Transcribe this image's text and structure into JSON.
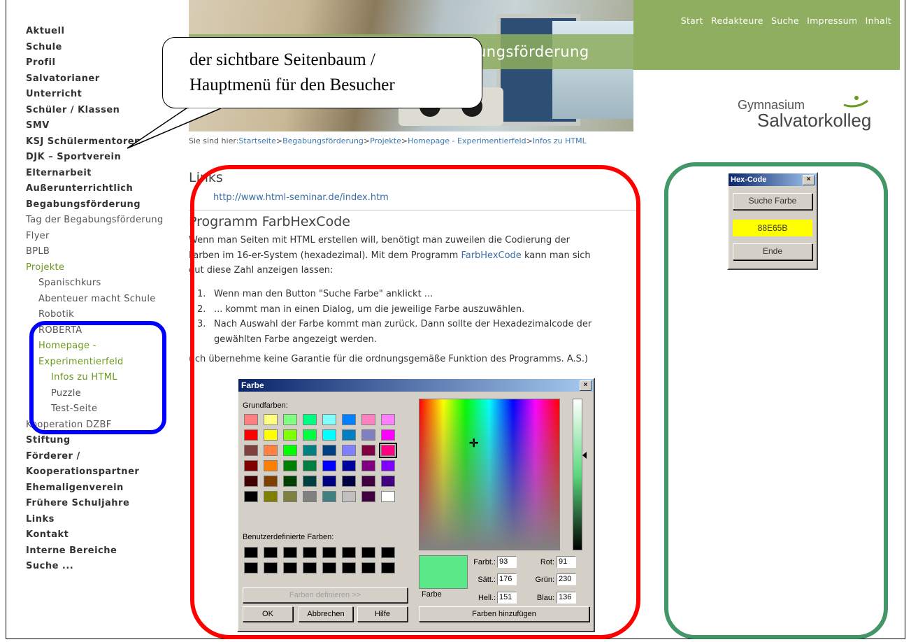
{
  "nav": {
    "items": [
      {
        "label": "Aktuell",
        "level": 0
      },
      {
        "label": "Schule",
        "level": 0
      },
      {
        "label": "Profil",
        "level": 0
      },
      {
        "label": "Salvatorianer",
        "level": 0
      },
      {
        "label": "Unterricht",
        "level": 0
      },
      {
        "label": "Schüler / Klassen",
        "level": 0
      },
      {
        "label": "SMV",
        "level": 0
      },
      {
        "label": "KSJ Schülermentoren",
        "level": 0
      },
      {
        "label": "DJK – Sportverein",
        "level": 0
      },
      {
        "label": "Elternarbeit",
        "level": 0
      },
      {
        "label": "Außerunterrichtlich",
        "level": 0
      },
      {
        "label": "Begabungsförderung",
        "level": 0
      },
      {
        "label": "Tag der Begabungsförderung",
        "level": 1
      },
      {
        "label": "Flyer",
        "level": 1
      },
      {
        "label": "BPLB",
        "level": 1
      },
      {
        "label": "Projekte",
        "level": 1,
        "active": true
      },
      {
        "label": "Spanischkurs",
        "level": 2
      },
      {
        "label": "Abenteuer macht Schule",
        "level": 2
      },
      {
        "label": "Robotik",
        "level": 2
      },
      {
        "label": "ROBERTA",
        "level": 2
      },
      {
        "label": "Homepage -",
        "level": 2,
        "active": true
      },
      {
        "label": "Experimentierfeld",
        "level": 2,
        "active": true
      },
      {
        "label": "Infos zu HTML",
        "level": 3,
        "active": true
      },
      {
        "label": "Puzzle",
        "level": 3
      },
      {
        "label": "Test-Seite",
        "level": 3
      },
      {
        "label": "Kooperation DZBF",
        "level": 1
      },
      {
        "label": "Stiftung",
        "level": 0
      },
      {
        "label": "Förderer /",
        "level": 0
      },
      {
        "label": "Kooperationspartner",
        "level": 0
      },
      {
        "label": "Ehemaligenverein",
        "level": 0
      },
      {
        "label": "Frühere Schuljahre",
        "level": 0
      },
      {
        "label": "Links",
        "level": 0
      },
      {
        "label": "Kontakt",
        "level": 0
      },
      {
        "label": "Interne Bereiche",
        "level": 0
      },
      {
        "label": "Suche ...",
        "level": 0
      }
    ]
  },
  "header": {
    "title": "ungsförderung",
    "topnav": [
      "Start",
      "Redakteure",
      "Suche",
      "Impressum",
      "Inhalt"
    ],
    "logo_top": "Gymnasium",
    "logo_bottom": "Salvatorkolleg"
  },
  "breadcrumb": {
    "prefix": "Sie sind hier:",
    "items": [
      "Startseite",
      "Begabungsförderung",
      "Projekte",
      "Homepage - Experimentierfeld",
      "Infos zu HTML"
    ],
    "separator": ">"
  },
  "content": {
    "links_heading": "Links",
    "link_url": "http://www.html-seminar.de/index.htm",
    "program_heading": "Programm FarbHexCode",
    "para_1": "Wenn man Seiten mit HTML erstellen will, benötigt man zuweilen die Codierung der",
    "para_2": "Farben im 16-er-System (hexadezimal). Mit dem Programm",
    "para_link": "FarbHexCode",
    "para_2b": "kann man sich",
    "para_3": "gut diese Zahl anzeigen lassen:",
    "steps": [
      {
        "n": "1.",
        "text": "Wenn man den Button \"Suche Farbe\" anklickt ..."
      },
      {
        "n": "2.",
        "text": "... kommt man in einen Dialog, um die jeweilige Farbe auszuwählen."
      },
      {
        "n": "3.",
        "text": "Nach Auswahl der Farbe kommt man zurück. Dann sollte der Hexadezimalcode der gewählten Farbe angezeigt werden."
      }
    ],
    "note": "(Ich übernehme keine Garantie für die ordnungsgemäße Funktion des Programms. A.S.)"
  },
  "color_dialog": {
    "title": "Farbe",
    "close": "×",
    "basic_label": "Grundfarben:",
    "custom_label": "Benutzerdefinierte Farben:",
    "define_btn": "Farben definieren >>",
    "ok_btn": "OK",
    "cancel_btn": "Abbrechen",
    "help_btn": "Hilfe",
    "add_btn": "Farben hinzufügen",
    "preview_label": "Farbe",
    "fields": {
      "hue_label": "Farbt.:",
      "hue": "93",
      "sat_label": "Sätt.:",
      "sat": "176",
      "lum_label": "Hell.:",
      "lum": "151",
      "red_label": "Rot:",
      "red": "91",
      "green_label": "Grün:",
      "green": "230",
      "blue_label": "Blau:",
      "blue": "136"
    },
    "basic_colors": [
      [
        "#ff8080",
        "#ffff80",
        "#80ff80",
        "#00ff80",
        "#80ffff",
        "#0080ff",
        "#ff80c0",
        "#ff80ff"
      ],
      [
        "#ff0000",
        "#ffff00",
        "#80ff00",
        "#00ff40",
        "#00ffff",
        "#0080c0",
        "#8080c0",
        "#ff00ff"
      ],
      [
        "#804040",
        "#ff8040",
        "#00ff00",
        "#008080",
        "#004080",
        "#8080ff",
        "#800040",
        "#ff0080"
      ],
      [
        "#800000",
        "#ff8000",
        "#008000",
        "#008040",
        "#0000ff",
        "#0000a0",
        "#800080",
        "#8000ff"
      ],
      [
        "#400000",
        "#804000",
        "#004000",
        "#004040",
        "#000080",
        "#000040",
        "#400040",
        "#400080"
      ],
      [
        "#000000",
        "#808000",
        "#808040",
        "#808080",
        "#408080",
        "#c0c0c0",
        "#400040",
        "#ffffff"
      ]
    ],
    "selected_swatch": "#ff0080",
    "preview_color": "#5be888"
  },
  "hex_dialog": {
    "title": "Hex-Code",
    "close": "×",
    "search_btn": "Suche Farbe",
    "code": "88E65B",
    "end_btn": "Ende"
  },
  "annotation": {
    "bubble_line1": "der sichtbare Seitenbaum /",
    "bubble_line2": "Hauptmenü für den Besucher"
  }
}
